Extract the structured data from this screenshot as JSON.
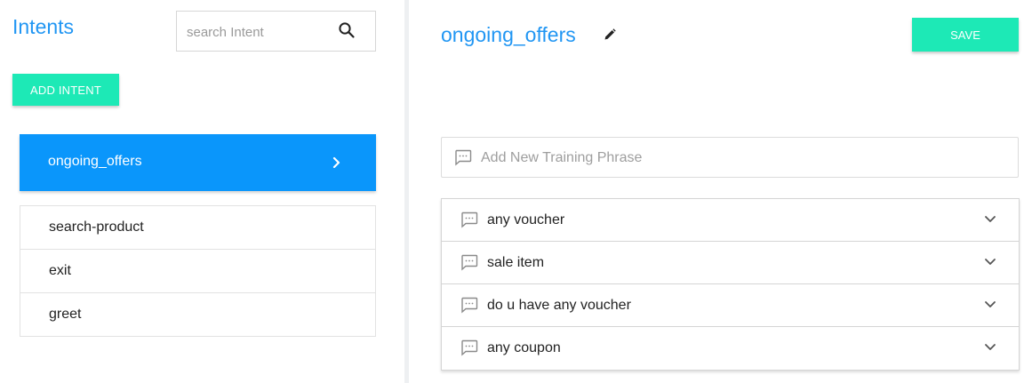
{
  "sidebar": {
    "title": "Intents",
    "search": {
      "placeholder": "search Intent",
      "value": "",
      "icon": "search-icon"
    },
    "add_intent_label": "ADD INTENT",
    "active_intent": {
      "label": "ongoing_offers",
      "icon": "chevron-right-icon"
    },
    "intents": [
      {
        "label": "search-product"
      },
      {
        "label": "exit"
      },
      {
        "label": "greet"
      }
    ]
  },
  "editor": {
    "intent_name": "ongoing_offers",
    "edit_icon": "pencil-icon",
    "save_label": "SAVE",
    "new_phrase": {
      "placeholder": "Add New Training Phrase",
      "value": "",
      "icon": "chat-icon"
    },
    "phrases": [
      {
        "text": "any voucher"
      },
      {
        "text": "sale item"
      },
      {
        "text": "do u have any voucher"
      },
      {
        "text": "any coupon"
      }
    ]
  },
  "colors": {
    "accent_blue": "#2196f3",
    "active_item": "#0a96fb",
    "button_green": "#1de9b6",
    "divider": "#eef0f2"
  }
}
